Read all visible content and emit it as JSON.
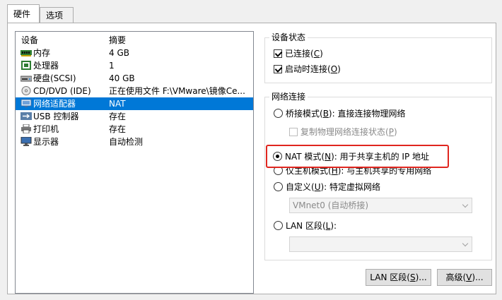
{
  "tabs": [
    {
      "label": "硬件",
      "active": true
    },
    {
      "label": "选项",
      "active": false
    }
  ],
  "device_list": {
    "headers": {
      "device": "设备",
      "summary": "摘要"
    },
    "rows": [
      {
        "icon": "memory-icon",
        "name": "内存",
        "summary": "4 GB",
        "selected": false
      },
      {
        "icon": "processor-icon",
        "name": "处理器",
        "summary": "1",
        "selected": false
      },
      {
        "icon": "hard-disk-icon",
        "name": "硬盘(SCSI)",
        "summary": "40 GB",
        "selected": false
      },
      {
        "icon": "cd-dvd-icon",
        "name": "CD/DVD (IDE)",
        "summary": "正在使用文件 F:\\VMware\\镜像Ce...",
        "selected": false
      },
      {
        "icon": "network-adapter-icon",
        "name": "网络适配器",
        "summary": "NAT",
        "selected": true
      },
      {
        "icon": "usb-controller-icon",
        "name": "USB 控制器",
        "summary": "存在",
        "selected": false
      },
      {
        "icon": "printer-icon",
        "name": "打印机",
        "summary": "存在",
        "selected": false
      },
      {
        "icon": "display-icon",
        "name": "显示器",
        "summary": "自动检测",
        "selected": false
      }
    ]
  },
  "device_status": {
    "title": "设备状态",
    "connected": {
      "label": "已连接(",
      "key": "C",
      "suffix": ")",
      "checked": true
    },
    "connect_on_start": {
      "label": "启动时连接(",
      "key": "O",
      "suffix": ")",
      "checked": true
    }
  },
  "network_connection": {
    "title": "网络连接",
    "bridged": {
      "label": "桥接模式(",
      "key": "B",
      "suffix": "): 直接连接物理网络",
      "checked": false
    },
    "replicate": {
      "label": "复制物理网络连接状态(",
      "key": "P",
      "suffix": ")",
      "checked": false,
      "enabled": false
    },
    "nat": {
      "label": "NAT 模式(",
      "key": "N",
      "suffix": "): 用于共享主机的 IP 地址",
      "checked": true
    },
    "host_only": {
      "label": "仅主机模式(",
      "key": "H",
      "suffix": "): 与主机共享的专用网络",
      "checked": false
    },
    "custom": {
      "label": "自定义(",
      "key": "U",
      "suffix": "): 特定虚拟网络",
      "checked": false
    },
    "custom_dropdown_value": "VMnet0 (自动桥接)",
    "lan_segment": {
      "label": "LAN 区段(",
      "key": "L",
      "suffix": "):",
      "checked": false
    },
    "lan_dropdown_value": ""
  },
  "buttons": {
    "lan_segments": {
      "label": "LAN 区段(",
      "key": "S",
      "suffix": ")..."
    },
    "advanced": {
      "label": "高级(",
      "key": "V",
      "suffix": ")..."
    }
  },
  "colors": {
    "selection": "#0078d7",
    "highlight_border": "#e0261f"
  }
}
